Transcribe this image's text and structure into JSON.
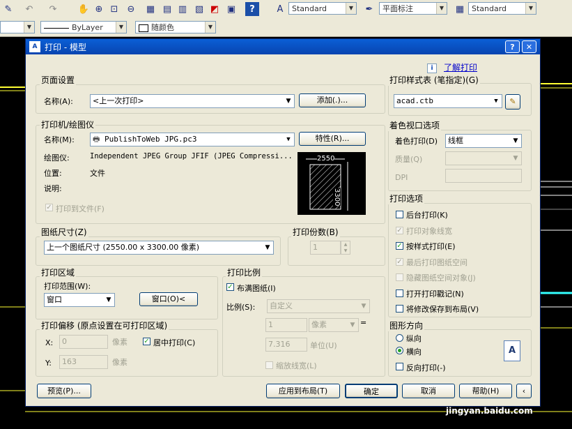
{
  "toolbar1": {
    "textstyle": "Standard",
    "dimstyle": "平面标注",
    "tablestyle": "Standard"
  },
  "toolbar2": {
    "linetype": "ByLayer",
    "color": "随颜色"
  },
  "dialog": {
    "title": "打印 - 模型",
    "help_button": "?",
    "close_button": "✕",
    "learn_link": "了解打印",
    "info_icon": "i",
    "page_setup": {
      "title": "页面设置",
      "name_label": "名称(A):",
      "name_value": "<上一次打印>",
      "add_button": "添加(.)..."
    },
    "printer": {
      "title": "打印机/绘图仪",
      "name_label": "名称(M):",
      "name_value": "PublishToWeb JPG.pc3",
      "properties_button": "特性(R)...",
      "plotter_label": "绘图仪:",
      "plotter_value": "Independent JPEG Group JFIF (JPEG Compressi...",
      "location_label": "位置:",
      "location_value": "文件",
      "description_label": "说明:",
      "print_to_file": "打印到文件(F)",
      "preview_width": "2550",
      "preview_height": "3300"
    },
    "paper_size": {
      "title": "图纸尺寸(Z)",
      "value": "上一个图纸尺寸   (2550.00 x 3300.00 像素)"
    },
    "copies": {
      "title": "打印份数(B)",
      "value": "1"
    },
    "plot_area": {
      "title": "打印区域",
      "range_label": "打印范围(W):",
      "range_value": "窗口",
      "window_button": "窗口(O)<"
    },
    "plot_offset": {
      "title": "打印偏移 (原点设置在可打印区域)",
      "x_label": "X:",
      "x_value": "0",
      "x_unit": "像素",
      "y_label": "Y:",
      "y_value": "163",
      "y_unit": "像素",
      "center_label": "居中打印(C)"
    },
    "plot_scale": {
      "title": "打印比例",
      "fit_label": "布满图纸(I)",
      "scale_label": "比例(S):",
      "scale_value": "自定义",
      "value1": "1",
      "unit1": "像素",
      "equals": "=",
      "value2": "7.316",
      "unit2": "单位(U)",
      "lineweight_label": "缩放线宽(L)"
    },
    "style_table": {
      "title": "打印样式表 (笔指定)(G)",
      "value": "acad.ctb"
    },
    "shaded_viewport": {
      "title": "着色视口选项",
      "shade_label": "着色打印(D)",
      "shade_value": "线框",
      "quality_label": "质量(Q)",
      "dpi_label": "DPI"
    },
    "plot_options": {
      "title": "打印选项",
      "items": [
        {
          "label": "后台打印(K)",
          "checked": false,
          "enabled": true
        },
        {
          "label": "打印对象线宽",
          "checked": true,
          "enabled": false
        },
        {
          "label": "按样式打印(E)",
          "checked": true,
          "enabled": true
        },
        {
          "label": "最后打印图纸空间",
          "checked": true,
          "enabled": false
        },
        {
          "label": "隐藏图纸空间对象(J)",
          "checked": false,
          "enabled": false
        },
        {
          "label": "打开打印戳记(N)",
          "checked": false,
          "enabled": true
        },
        {
          "label": "将修改保存到布局(V)",
          "checked": false,
          "enabled": true
        }
      ]
    },
    "orientation": {
      "title": "图形方向",
      "portrait": "纵向",
      "landscape": "横向",
      "upside_down": "反向打印(-)",
      "selected": "landscape",
      "icon_letter": "A"
    },
    "footer": {
      "preview_button": "预览(P)...",
      "apply_button": "应用到布局(T)",
      "ok_button": "确定",
      "cancel_button": "取消",
      "help_button": "帮助(H)"
    }
  },
  "watermark": "jingyan.baidu.com",
  "colors": {
    "accent": "#0a246a",
    "background": "#ece9d8",
    "check": "#21a121"
  }
}
